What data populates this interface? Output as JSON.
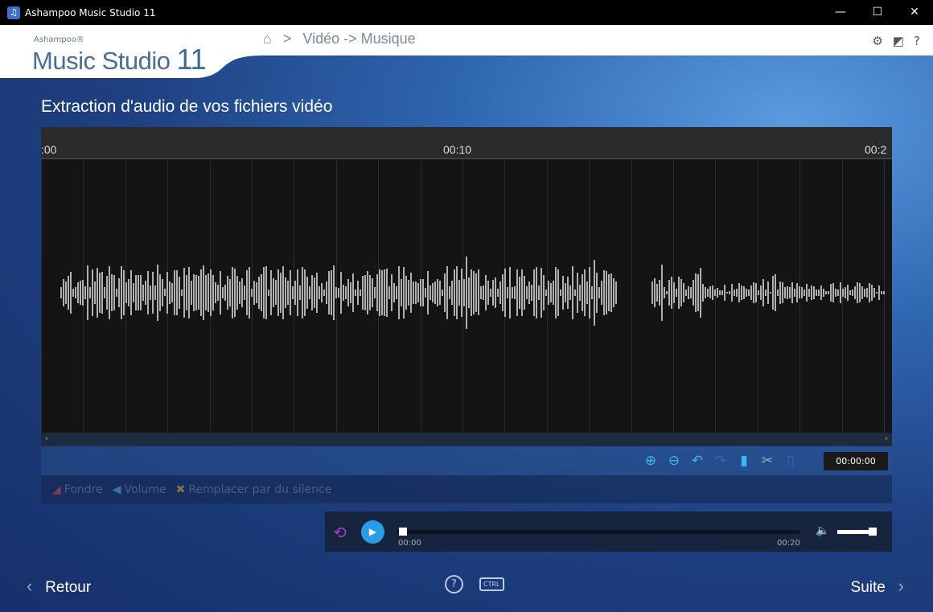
{
  "window": {
    "title": "Ashampoo Music Studio 11",
    "minimize": "—",
    "maximize": "☐",
    "close": "✕"
  },
  "header": {
    "brand_small": "Ashampoo®",
    "brand": "Music Studio",
    "brand_version": "11",
    "breadcrumb_sep": ">",
    "breadcrumb": "Vidéo -> Musique",
    "icons": {
      "settings": "⚙",
      "skin": "◩",
      "help": "?"
    }
  },
  "page_title": "Extraction d'audio de vos fichiers vidéo",
  "ruler": {
    "ticks": [
      ":00",
      "00:10",
      "00:2"
    ]
  },
  "timeline_time": "00:00:00",
  "tools": {
    "zoom_in": "⊕",
    "zoom_out": "⊖",
    "undo": "↶",
    "redo": "↷",
    "copy": "▮",
    "cut": "✂",
    "paste": "▯"
  },
  "effects": [
    {
      "icon": "◢",
      "label": "Fondre"
    },
    {
      "icon": "◀",
      "label": "Volume"
    },
    {
      "icon": "✖",
      "label": "Remplacer par du silence"
    }
  ],
  "player": {
    "loop": "⟲",
    "play": "▶",
    "start": "00:00",
    "end": "00:20",
    "speaker": "🔈",
    "position": 0,
    "volume": 0.9
  },
  "footer": {
    "back": "Retour",
    "next": "Suite",
    "back_chev": "‹",
    "next_chev": "›",
    "help": "?",
    "ctrl": "CTRL"
  }
}
